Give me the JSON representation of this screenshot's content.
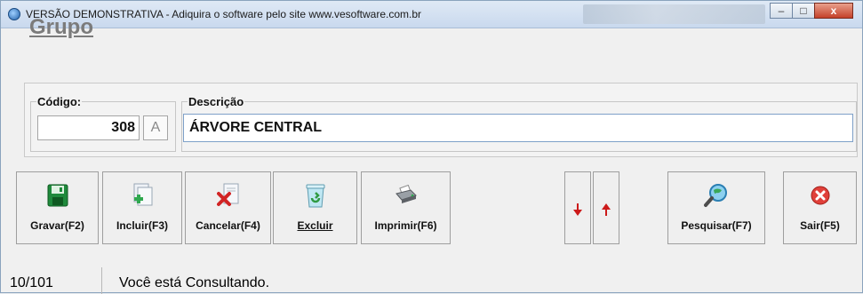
{
  "window": {
    "title": "VERSÃO DEMONSTRATIVA - Adiquira o software pelo site www.vesoftware.com.br",
    "minimize_glyph": "–",
    "maximize_glyph": "□",
    "close_glyph": "x"
  },
  "form": {
    "heading": "Grupo",
    "codigo_label": "Código:",
    "codigo_value": "308",
    "status_value": "A",
    "descricao_label": "Descrição",
    "descricao_value": "ÁRVORE CENTRAL"
  },
  "toolbar": {
    "gravar": "Gravar(F2)",
    "incluir": "Incluir(F3)",
    "cancelar": "Cancelar(F4)",
    "excluir": "Excluir",
    "imprimir": "Imprimir(F6)",
    "pesquisar": "Pesquisar(F7)",
    "sair": "Sair(F5)"
  },
  "icons": {
    "app": "app-icon",
    "gravar": "floppy-disk-icon",
    "incluir": "add-document-icon",
    "cancelar": "cancel-document-icon",
    "excluir": "recycle-bin-icon",
    "imprimir": "printer-icon",
    "down": "arrow-down-icon",
    "up": "arrow-up-icon",
    "pesquisar": "magnifier-globe-icon",
    "sair": "close-circle-icon"
  },
  "status": {
    "record_count": "10/101",
    "message": "Você está Consultando."
  },
  "colors": {
    "heading": "#7b7b7b",
    "arrow_red": "#cc1a1a",
    "close_red": "#c4412a"
  }
}
